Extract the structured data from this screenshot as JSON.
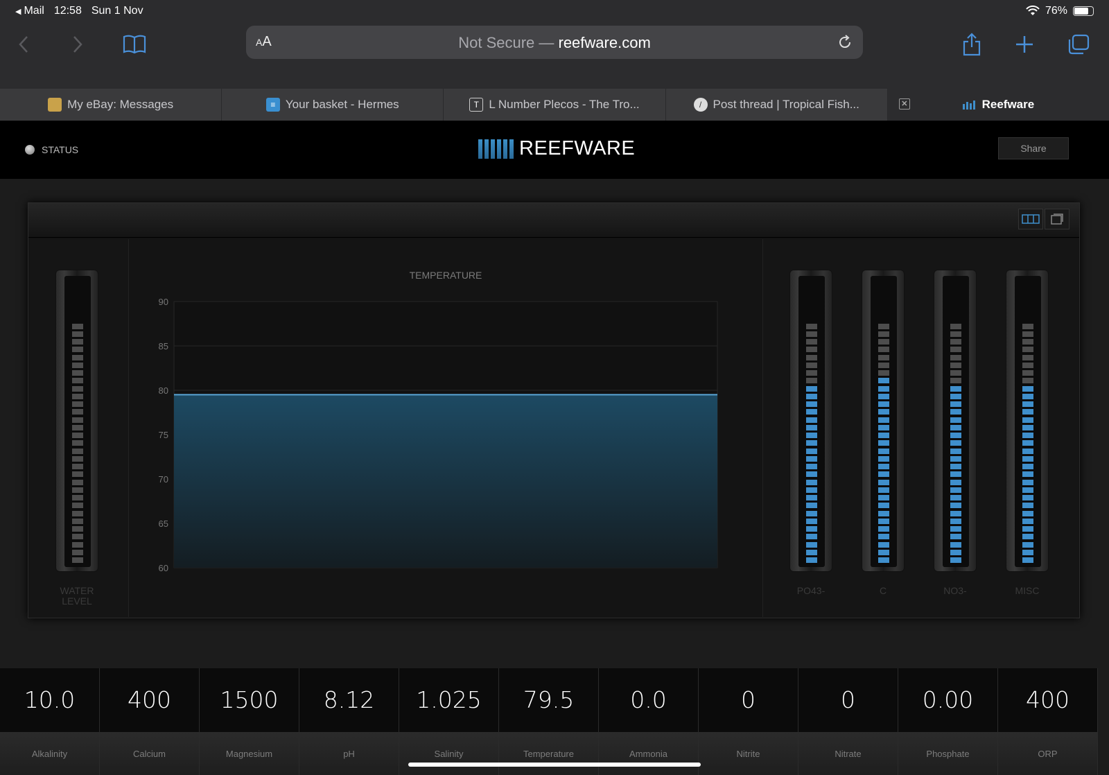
{
  "status_bar": {
    "back_app": "Mail",
    "time": "12:58",
    "date": "Sun 1 Nov",
    "battery": "76%",
    "battery_level": 0.76
  },
  "browser": {
    "aa_small": "A",
    "aa_big": "A",
    "url_prefix": "Not Secure — ",
    "url_domain": "reefware.com",
    "tabs": [
      {
        "label": "My eBay: Messages",
        "active": false
      },
      {
        "label": "Your basket - Hermes",
        "active": false
      },
      {
        "label": "L Number Plecos - The Tro...",
        "active": false
      },
      {
        "label": "Post thread | Tropical Fish...",
        "active": false
      },
      {
        "label": "Reefware",
        "active": true
      }
    ],
    "tab4_favicon": "T"
  },
  "header": {
    "status_label": "STATUS",
    "logo_text": "REEFWARE",
    "share_label": "Share"
  },
  "meters": {
    "left": {
      "label_line1": "WATER",
      "label_line2": "LEVEL",
      "level": 0.0
    },
    "right": [
      {
        "label": "PO43-",
        "level": 0.74
      },
      {
        "label": "C",
        "level": 0.76
      },
      {
        "label": "NO3-",
        "level": 0.74
      },
      {
        "label": "MISC",
        "level": 0.74
      }
    ]
  },
  "chart_data": {
    "type": "area",
    "title": "TEMPERATURE",
    "x": [
      0,
      1
    ],
    "values": [
      79.5,
      79.5
    ],
    "ylim": [
      60,
      90
    ],
    "yticks": [
      90,
      85,
      80,
      75,
      70,
      65,
      60
    ],
    "grid": true,
    "color": "#3f8fcc"
  },
  "readouts": [
    {
      "value": "10.0",
      "label": "Alkalinity"
    },
    {
      "value": "400",
      "label": "Calcium"
    },
    {
      "value": "1500",
      "label": "Magnesium"
    },
    {
      "value": "8.12",
      "label": "pH"
    },
    {
      "value": "1.025",
      "label": "Salinity"
    },
    {
      "value": "79.5",
      "label": "Temperature"
    },
    {
      "value": "0.0",
      "label": "Ammonia"
    },
    {
      "value": "0",
      "label": "Nitrite"
    },
    {
      "value": "0",
      "label": "Nitrate"
    },
    {
      "value": "0.00",
      "label": "Phosphate"
    },
    {
      "value": "400",
      "label": "ORP"
    }
  ],
  "colors": {
    "accent": "#3f8fcc",
    "tab_icon": "#4a90d9"
  }
}
